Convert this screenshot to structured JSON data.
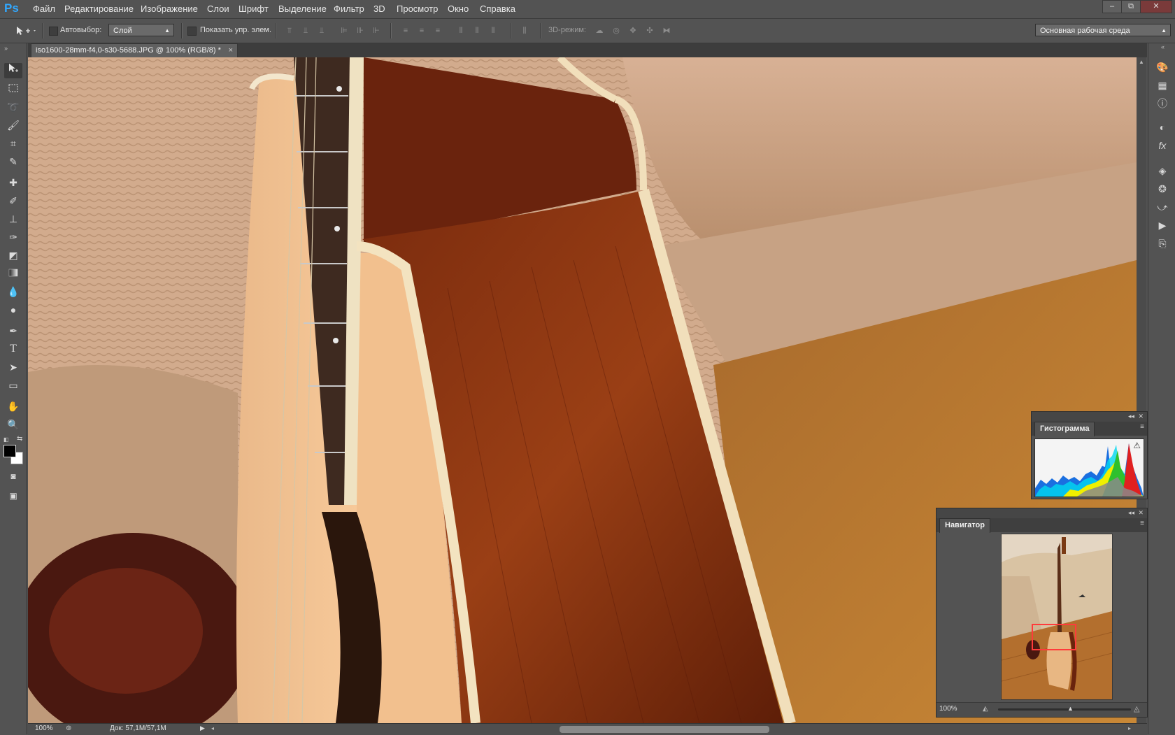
{
  "app": {
    "logo": "Ps",
    "menu": [
      "Файл",
      "Редактирование",
      "Изображение",
      "Слои",
      "Шрифт",
      "Выделение",
      "Фильтр",
      "3D",
      "Просмотр",
      "Окно",
      "Справка"
    ],
    "window_controls": {
      "minimize": "–",
      "restore": "⧉",
      "close": "✕"
    }
  },
  "options_bar": {
    "autoselect_label": "Автовыбор:",
    "autoselect_value": "Слой",
    "show_transform_label": "Показать упр. элем.",
    "mode_3d_label": "3D-режим:",
    "workspace_value": "Основная рабочая среда"
  },
  "document": {
    "tab_title": "iso1600-28mm-f4,0-s30-5688.JPG @ 100% (RGB/8) *",
    "close": "×"
  },
  "status": {
    "zoom": "100%",
    "doc_size": "Док: 57,1M/57,1M"
  },
  "panels": {
    "histogram": {
      "title": "Гистограмма",
      "warning": "⚠"
    },
    "navigator": {
      "title": "Навигатор",
      "zoom": "100%"
    }
  },
  "tools": [
    "move-tool",
    "marquee-tool",
    "lasso-tool",
    "quick-select-tool",
    "crop-tool",
    "eyedropper-tool",
    "spot-healing-tool",
    "brush-tool",
    "clone-stamp-tool",
    "history-brush-tool",
    "eraser-tool",
    "gradient-tool",
    "blur-tool",
    "dodge-tool",
    "pen-tool",
    "type-tool",
    "path-select-tool",
    "rectangle-tool",
    "hand-tool",
    "zoom-tool"
  ],
  "colors": {
    "ui_bg": "#535353",
    "accent": "#31a8ff",
    "nav_view_box": "#ff3b3b"
  }
}
